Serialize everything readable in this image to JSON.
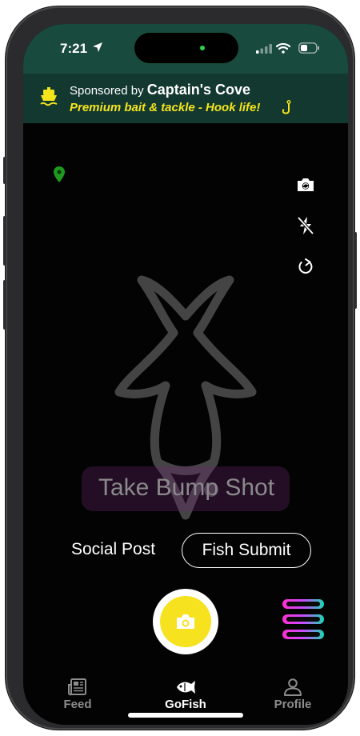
{
  "status_bar": {
    "time": "7:21",
    "background": "#184a3d"
  },
  "sponsor": {
    "prefix": "Sponsored by",
    "brand": "Captain's Cove",
    "tagline": "Premium bait & tackle - Hook life!",
    "icon": "boat-icon",
    "accent": "#f4e41c"
  },
  "camera": {
    "prompt": "Take Bump Shot",
    "tools": [
      "camera-flip-icon",
      "flash-off-icon",
      "rotate-icon"
    ]
  },
  "modes": {
    "social": "Social Post",
    "fish_submit": "Fish Submit",
    "selected": "Fish Submit"
  },
  "shutter": {
    "icon": "camera-icon",
    "color": "#f7e21f"
  },
  "tabs": [
    {
      "label": "Feed",
      "icon": "newspaper-icon",
      "active": false
    },
    {
      "label": "GoFish",
      "icon": "fish-icon",
      "active": true
    },
    {
      "label": "Profile",
      "icon": "person-icon",
      "active": false
    }
  ]
}
